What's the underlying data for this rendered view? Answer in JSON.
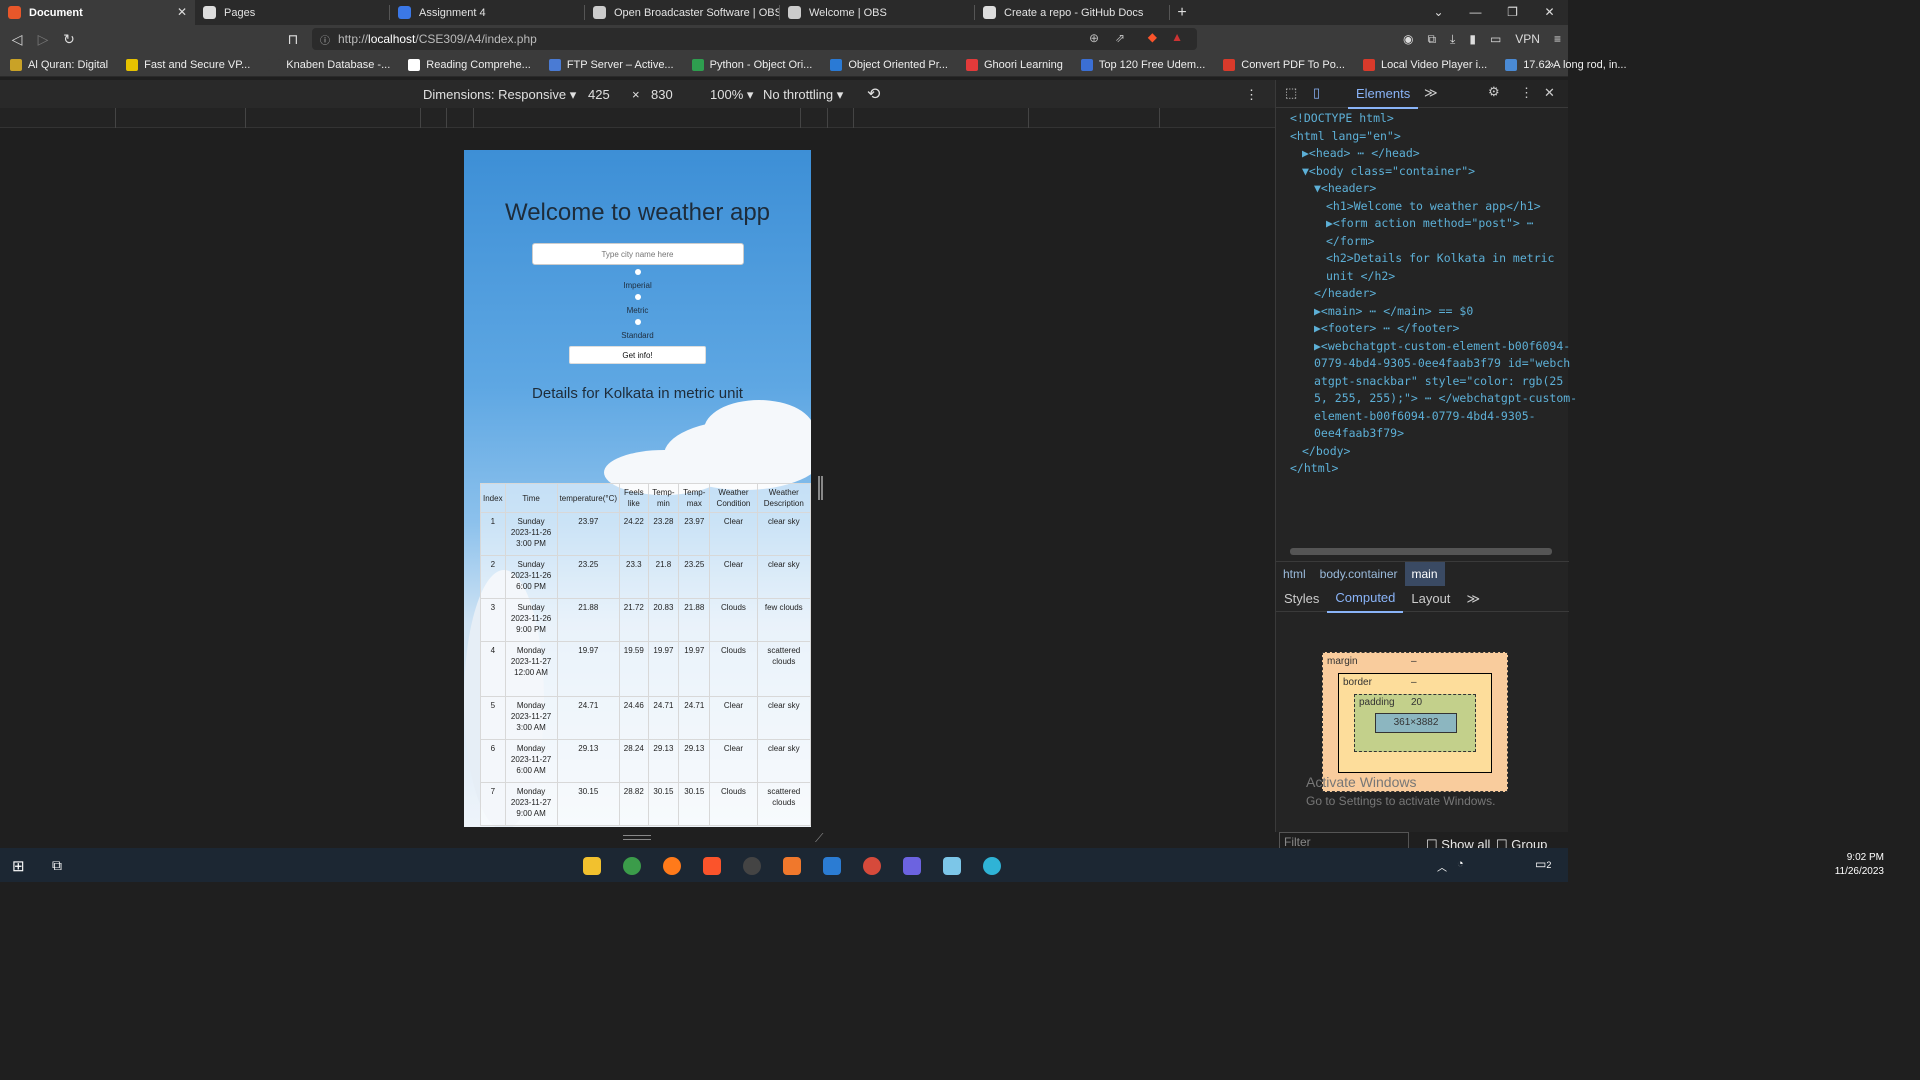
{
  "browser": {
    "tabs": [
      {
        "label": "Document",
        "active": true,
        "color": "#e8572a"
      },
      {
        "label": "Pages",
        "active": false,
        "color": "#dddddd"
      },
      {
        "label": "Assignment 4",
        "active": false,
        "color": "#3b78e7"
      },
      {
        "label": "Open Broadcaster Software | OBS",
        "active": false,
        "color": "#cccccc"
      },
      {
        "label": "Welcome | OBS",
        "active": false,
        "color": "#cccccc"
      },
      {
        "label": "Create a repo - GitHub Docs",
        "active": false,
        "color": "#dddddd"
      }
    ],
    "url_prefix": "http://",
    "url_host": "localhost",
    "url_path": "/CSE309/A4/index.php",
    "vpn_label": "VPN",
    "bookmarks": [
      {
        "label": "Al Quran: Digital",
        "color": "#c9a227"
      },
      {
        "label": "Fast and Secure VP...",
        "color": "#e6c200"
      },
      {
        "label": "Knaben Database -...",
        "color": "#3b3b3b"
      },
      {
        "label": "Reading Comprehe...",
        "color": "#ffffff"
      },
      {
        "label": "FTP Server – Active...",
        "color": "#4a7bd4"
      },
      {
        "label": "Python - Object Ori...",
        "color": "#2e9e4f"
      },
      {
        "label": "Object Oriented Pr...",
        "color": "#2a7ad5"
      },
      {
        "label": "Ghoori Learning",
        "color": "#e23a3a"
      },
      {
        "label": "Top 120 Free Udem...",
        "color": "#3b6fd4"
      },
      {
        "label": "Convert PDF To Po...",
        "color": "#d93a2b"
      },
      {
        "label": "Local Video Player i...",
        "color": "#d93a2b"
      },
      {
        "label": "17.62 A long rod, in...",
        "color": "#4a8ad4"
      }
    ]
  },
  "devtools_toolbar": {
    "dimensions_label": "Dimensions: Responsive",
    "width": "425",
    "times": "×",
    "height": "830",
    "zoom": "100%",
    "throttling": "No throttling"
  },
  "app": {
    "title": "Welcome to weather app",
    "search_placeholder": "Type city name here",
    "units": [
      "Imperial",
      "Metric",
      "Standard"
    ],
    "submit_label": "Get info!",
    "details_heading": "Details for Kolkata in metric unit",
    "table_headers": [
      "Index",
      "Time",
      "temperature(°C)",
      "Feels like",
      "Temp-min",
      "Temp-max",
      "Weather Condition",
      "Weather Description"
    ],
    "rows": [
      [
        "1",
        "Sunday 2023-11-26 3:00 PM",
        "23.97",
        "24.22",
        "23.28",
        "23.97",
        "Clear",
        "clear sky"
      ],
      [
        "2",
        "Sunday 2023-11-26 6:00 PM",
        "23.25",
        "23.3",
        "21.8",
        "23.25",
        "Clear",
        "clear sky"
      ],
      [
        "3",
        "Sunday 2023-11-26 9:00 PM",
        "21.88",
        "21.72",
        "20.83",
        "21.88",
        "Clouds",
        "few clouds"
      ],
      [
        "4",
        "Monday 2023-11-27 12:00 AM",
        "19.97",
        "19.59",
        "19.97",
        "19.97",
        "Clouds",
        "scattered clouds"
      ],
      [
        "5",
        "Monday 2023-11-27 3:00 AM",
        "24.71",
        "24.46",
        "24.71",
        "24.71",
        "Clear",
        "clear sky"
      ],
      [
        "6",
        "Monday 2023-11-27 6:00 AM",
        "29.13",
        "28.24",
        "29.13",
        "29.13",
        "Clear",
        "clear sky"
      ],
      [
        "7",
        "Monday 2023-11-27 9:00 AM",
        "30.15",
        "28.82",
        "30.15",
        "30.15",
        "Clouds",
        "scattered clouds"
      ]
    ]
  },
  "devtools_panel": {
    "active_tab": "Elements",
    "dom_lines": [
      {
        "indent": 0,
        "html": "<!DOCTYPE html>"
      },
      {
        "indent": 0,
        "html": "<html lang=\"en\">"
      },
      {
        "indent": 1,
        "html": "▶<head> ⋯ </head>"
      },
      {
        "indent": 1,
        "html": "▼<body class=\"container\">"
      },
      {
        "indent": 2,
        "html": "▼<header>"
      },
      {
        "indent": 3,
        "html": "<h1>Welcome to weather app</h1>"
      },
      {
        "indent": 3,
        "html": "▶<form action method=\"post\"> ⋯"
      },
      {
        "indent": 3,
        "html": "</form>"
      },
      {
        "indent": 3,
        "html": "<h2>Details for Kolkata in metric"
      },
      {
        "indent": 3,
        "html": "unit </h2>"
      },
      {
        "indent": 2,
        "html": "</header>"
      },
      {
        "indent": 2,
        "html": "▶<main> ⋯ </main> == $0"
      },
      {
        "indent": 2,
        "html": "▶<footer> ⋯ </footer>"
      },
      {
        "indent": 2,
        "html": "▶<webchatgpt-custom-element-b00f6094-"
      },
      {
        "indent": 2,
        "html": "0779-4bd4-9305-0ee4faab3f79 id=\"webch"
      },
      {
        "indent": 2,
        "html": "atgpt-snackbar\" style=\"color: rgb(25"
      },
      {
        "indent": 2,
        "html": "5, 255, 255);\"> ⋯ </webchatgpt-custom-"
      },
      {
        "indent": 2,
        "html": "element-b00f6094-0779-4bd4-9305-"
      },
      {
        "indent": 2,
        "html": "0ee4faab3f79>"
      },
      {
        "indent": 1,
        "html": "</body>"
      },
      {
        "indent": 0,
        "html": "</html>"
      }
    ],
    "breadcrumbs": [
      "html",
      "body.container",
      "main"
    ],
    "subtabs": [
      "Styles",
      "Computed",
      "Layout"
    ],
    "active_subtab": "Computed",
    "box_model": {
      "margin_label": "margin",
      "margin_value": "–",
      "border_label": "border",
      "border_value": "–",
      "padding_label": "padding",
      "padding_value": "20",
      "content": "361×3882"
    },
    "activate_title": "Activate Windows",
    "activate_sub": "Go to Settings to activate Windows.",
    "filter_placeholder": "Filter",
    "show_all": "Show all",
    "group": "Group"
  },
  "taskbar": {
    "time": "9:02 PM",
    "date": "11/26/2023",
    "notifications": "2"
  }
}
